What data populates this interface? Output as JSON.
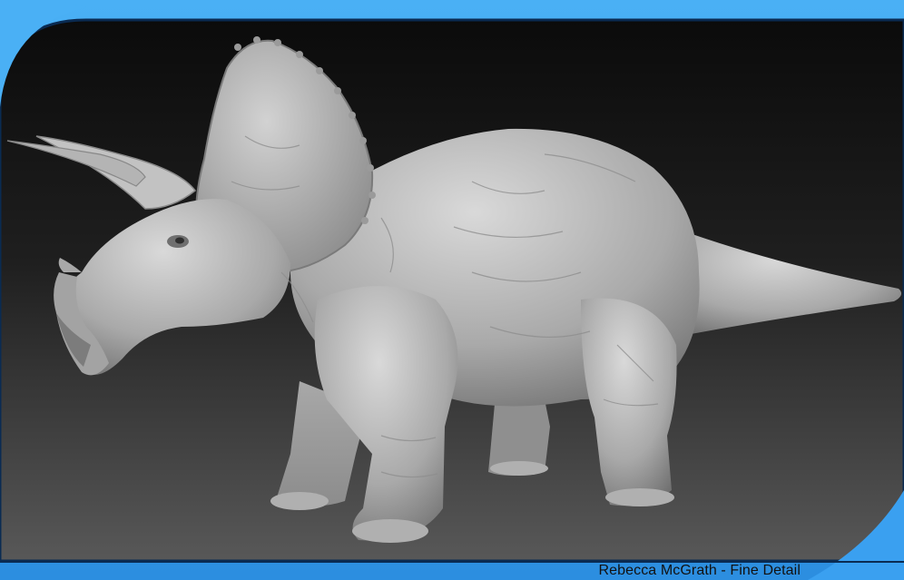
{
  "caption": "Rebecca McGrath - Fine Detail",
  "colors": {
    "frame_blue": "#3aa0f0",
    "frame_dark": "#0a2b52",
    "background_top": "#0c0c0c",
    "background_bottom": "#5a5a5a",
    "sculpt_gray": "#b9b9b9"
  },
  "subject": "triceratops-sculpt"
}
